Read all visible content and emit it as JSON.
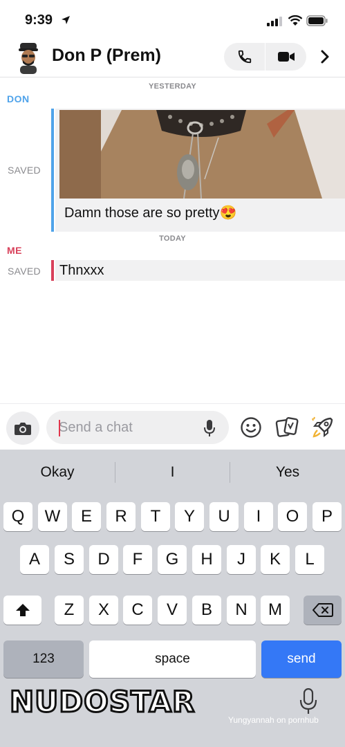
{
  "status_bar": {
    "time": "9:39"
  },
  "header": {
    "contact_name": "Don P (Prem)",
    "icons": [
      "avatar",
      "phone-icon",
      "video-icon",
      "chevron-right-icon"
    ]
  },
  "chat": {
    "yesterday_label": "YESTERDAY",
    "today_label": "TODAY",
    "don_section": {
      "sender": "DON",
      "saved_label": "SAVED",
      "message": "Damn those are so pretty😍",
      "accent_color": "#4fa3ea"
    },
    "me_section": {
      "sender": "ME",
      "saved_label": "SAVED",
      "message": "Thnxxx",
      "accent_color": "#d8405a"
    }
  },
  "input_bar": {
    "placeholder": "Send a chat",
    "icons": [
      "camera-icon",
      "mic-icon",
      "smiley-icon",
      "sticker-icon",
      "rocket-icon"
    ]
  },
  "keyboard": {
    "suggestions": [
      "Okay",
      "I",
      "Yes"
    ],
    "row1": [
      "Q",
      "W",
      "E",
      "R",
      "T",
      "Y",
      "U",
      "I",
      "O",
      "P"
    ],
    "row2": [
      "A",
      "S",
      "D",
      "F",
      "G",
      "H",
      "J",
      "K",
      "L"
    ],
    "row3": [
      "Z",
      "X",
      "C",
      "V",
      "B",
      "N",
      "M"
    ],
    "numbers_key": "123",
    "space_key": "space",
    "send_key": "send"
  },
  "watermark": {
    "logo": "NUDOSTAR",
    "credit": "Yungyannah on pornhub"
  },
  "colors": {
    "don": "#4fa3ea",
    "me": "#d8405a",
    "send_key": "#3478f6",
    "keyboard_bg": "#d2d4d9"
  }
}
